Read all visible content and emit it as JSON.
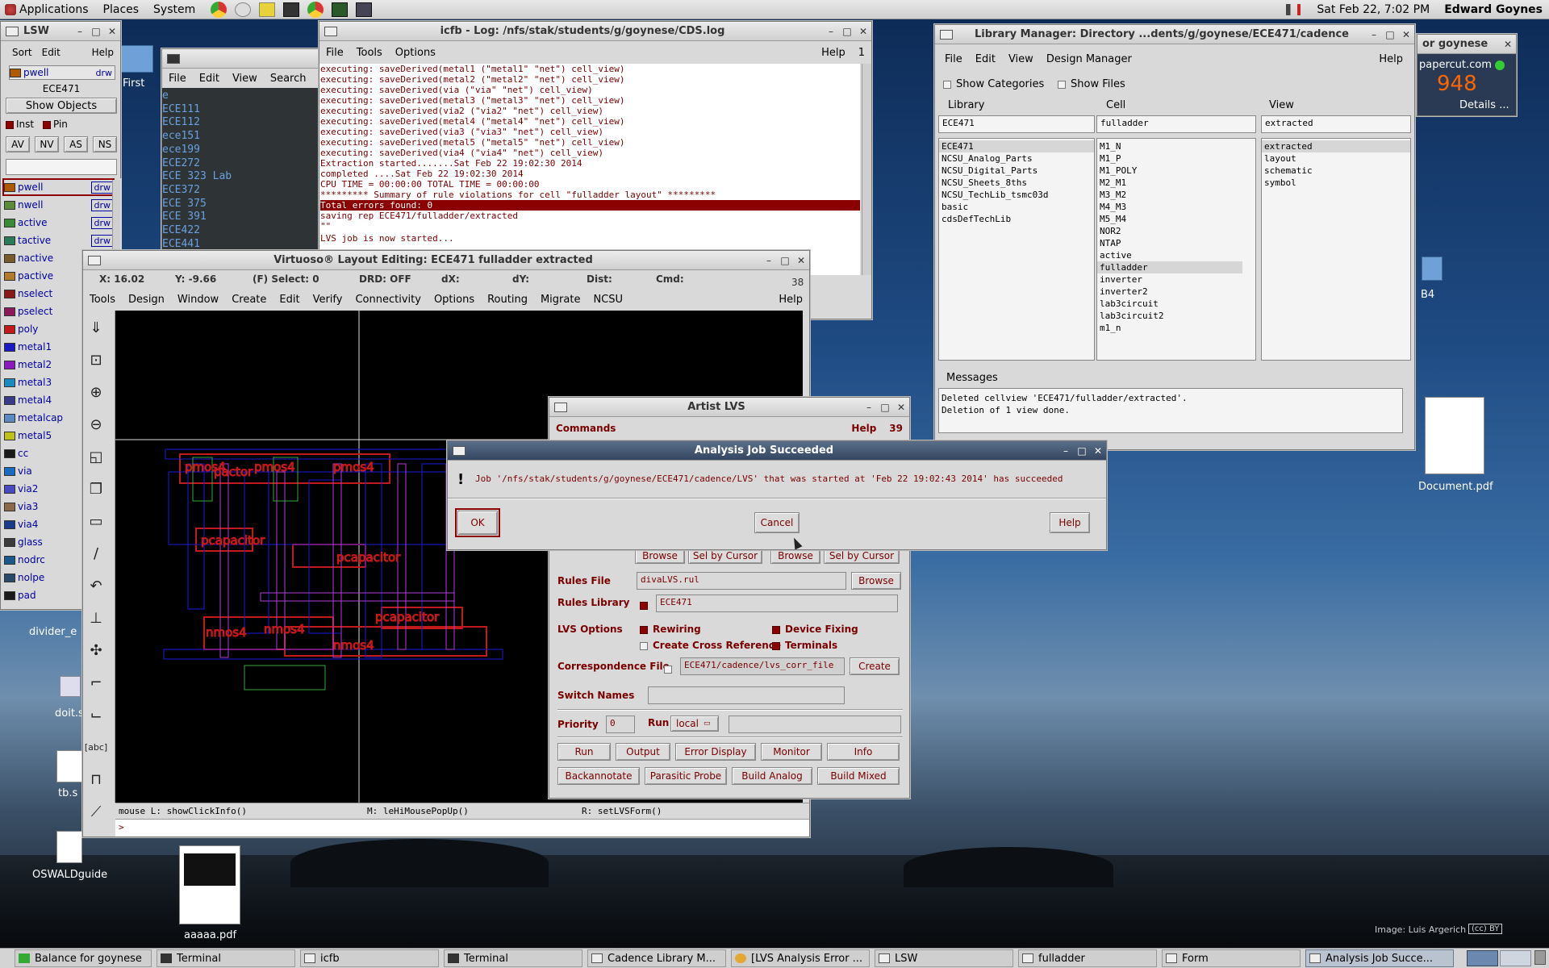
{
  "top_panel": {
    "applications": "Applications",
    "places": "Places",
    "system": "System",
    "clock": "Sat Feb 22,  7:02 PM",
    "user": "Edward Goynes"
  },
  "desktop": {
    "first_label": "First",
    "b4_label": "B4",
    "divider_label": "divider_e",
    "doit_label": "doit.s",
    "tb_label": "tb.s",
    "oswald_label": "OSWALDguide",
    "document_label": "Document.pdf",
    "aaaaa_label": "aaaaa.pdf",
    "credit": "Image: Luis Argerich",
    "cc": "(cc) BY"
  },
  "papercut": {
    "title": "or goynese",
    "site": "papercut.com",
    "count": "948",
    "details": "Details ..."
  },
  "lsw": {
    "title": "LSW",
    "menu": [
      "Sort",
      "Edit",
      "Help"
    ],
    "current_layer": "pwell",
    "current_purpose": "drw",
    "lib": "ECE471",
    "show_objects": "Show Objects",
    "inst": "Inst",
    "pin": "Pin",
    "buttons": [
      "AV",
      "NV",
      "AS",
      "NS"
    ],
    "layers": [
      {
        "name": "pwell",
        "purpose": "drw",
        "color": "#b05a00"
      },
      {
        "name": "nwell",
        "purpose": "drw",
        "color": "#5a8a3a"
      },
      {
        "name": "active",
        "purpose": "drw",
        "color": "#3a8a3a"
      },
      {
        "name": "tactive",
        "purpose": "drw",
        "color": "#2a7a5a"
      },
      {
        "name": "nactive",
        "purpose": "",
        "color": "#7a5a2a"
      },
      {
        "name": "pactive",
        "purpose": "",
        "color": "#b07a2a"
      },
      {
        "name": "nselect",
        "purpose": "",
        "color": "#8a1a1a"
      },
      {
        "name": "pselect",
        "purpose": "",
        "color": "#8a1a5a"
      },
      {
        "name": "poly",
        "purpose": "",
        "color": "#c01a1a"
      },
      {
        "name": "metal1",
        "purpose": "",
        "color": "#1a1ac0"
      },
      {
        "name": "metal2",
        "purpose": "",
        "color": "#8a1ac0"
      },
      {
        "name": "metal3",
        "purpose": "",
        "color": "#1a8ac0"
      },
      {
        "name": "metal4",
        "purpose": "",
        "color": "#3a3a8a"
      },
      {
        "name": "metalcap",
        "purpose": "",
        "color": "#5a8ac0"
      },
      {
        "name": "metal5",
        "purpose": "",
        "color": "#c0c01a"
      },
      {
        "name": "cc",
        "purpose": "",
        "color": "#1a1a1a"
      },
      {
        "name": "via",
        "purpose": "",
        "color": "#1a6ac0"
      },
      {
        "name": "via2",
        "purpose": "",
        "color": "#4a4ac0"
      },
      {
        "name": "via3",
        "purpose": "",
        "color": "#8a6a4a"
      },
      {
        "name": "via4",
        "purpose": "",
        "color": "#1a3a8a"
      },
      {
        "name": "glass",
        "purpose": "",
        "color": "#3a3a3a"
      },
      {
        "name": "nodrc",
        "purpose": "",
        "color": "#1a5a8a"
      },
      {
        "name": "nolpe",
        "purpose": "",
        "color": "#2a4a6a"
      },
      {
        "name": "pad",
        "purpose": "",
        "color": "#1a1a1a"
      }
    ]
  },
  "terminal": {
    "menu": [
      "File",
      "Edit",
      "View",
      "Search",
      "Te"
    ],
    "lines": [
      "e",
      "ECE111",
      "ECE112",
      "ece151",
      "ece199",
      "ECE272",
      "ECE 323 Lab",
      "ECE372",
      "ECE 375",
      "ECE 391",
      "ECE422",
      "ECE441"
    ]
  },
  "icfb": {
    "title": "icfb - Log: /nfs/stak/students/g/goynese/CDS.log",
    "menu": [
      "File",
      "Tools",
      "Options"
    ],
    "help": "Help",
    "num": "1",
    "lines": [
      "executing: saveDerived(metal1 (\"metal1\" \"net\") cell_view)",
      "executing: saveDerived(metal2 (\"metal2\" \"net\") cell_view)",
      "executing: saveDerived(via (\"via\" \"net\") cell_view)",
      "executing: saveDerived(metal3 (\"metal3\" \"net\") cell_view)",
      "executing: saveDerived(via2 (\"via2\" \"net\") cell_view)",
      "executing: saveDerived(metal4 (\"metal4\" \"net\") cell_view)",
      "executing: saveDerived(via3 (\"via3\" \"net\") cell_view)",
      "executing: saveDerived(metal5 (\"metal5\" \"net\") cell_view)",
      "executing: saveDerived(via4 (\"via4\" \"net\") cell_view)",
      "Extraction started.......Sat Feb 22 19:02:30 2014",
      "           completed ....Sat Feb 22 19:02:30 2014",
      "    CPU TIME = 00:00:00  TOTAL TIME = 00:00:00",
      "*********   Summary of rule violations for cell \"fulladder layout\"   *********",
      "    Total errors found: 0",
      "saving rep ECE471/fulladder/extracted",
      "\"\"",
      "LVS job is now started..."
    ]
  },
  "library_manager": {
    "title": "Library Manager: Directory ...dents/g/goynese/ECE471/cadence",
    "menu": [
      "File",
      "Edit",
      "View",
      "Design Manager"
    ],
    "help": "Help",
    "show_categories": "Show Categories",
    "show_files": "Show Files",
    "lib_header": "Library",
    "cell_header": "Cell",
    "view_header": "View",
    "lib_value": "ECE471",
    "cell_value": "fulladder",
    "view_value": "extracted",
    "libraries": [
      "ECE471",
      "NCSU_Analog_Parts",
      "NCSU_Digital_Parts",
      "NCSU_Sheets_8ths",
      "NCSU_TechLib_tsmc03d",
      "basic",
      "cdsDefTechLib"
    ],
    "cells": [
      "M1_N",
      "M1_P",
      "M1_POLY",
      "M2_M1",
      "M3_M2",
      "M4_M3",
      "M5_M4",
      "NOR2",
      "NTAP",
      "active",
      "fulladder",
      "inverter",
      "inverter2",
      "lab3circuit",
      "lab3circuit2",
      "m1_n"
    ],
    "views": [
      "extracted",
      "layout",
      "schematic",
      "symbol"
    ],
    "messages_label": "Messages",
    "messages": [
      "Deleted cellview 'ECE471/fulladder/extracted'.",
      "Deletion of 1 view done."
    ]
  },
  "virtuoso": {
    "title": "Virtuoso® Layout Editing: ECE471 fulladder extracted",
    "x": "X: 16.02",
    "y": "Y: -9.66",
    "select": "(F) Select: 0",
    "drd": "DRD: OFF",
    "dx": "dX:",
    "dy": "dY:",
    "dist": "Dist:",
    "cmd": "Cmd:",
    "num": "38",
    "menu": [
      "Tools",
      "Design",
      "Window",
      "Create",
      "Edit",
      "Verify",
      "Connectivity",
      "Options",
      "Routing",
      "Migrate",
      "NCSU"
    ],
    "help": "Help",
    "mouse_l": "mouse L: showClickInfo()",
    "mouse_m": "M: leHiMousePopUp()",
    "mouse_r": "R: setLVSForm()",
    "prompt": ">",
    "layout_labels": [
      "pmos4",
      "pmos4",
      "pmos4",
      "pactor",
      "pcapacitor",
      "pcapacitor",
      "pcapacitor",
      "nmos4",
      "nmos4",
      "nmos4"
    ]
  },
  "artist_lvs": {
    "title": "Artist LVS",
    "commands": "Commands",
    "help": "Help",
    "num": "39",
    "browse1": "Browse",
    "selcursor1": "Sel by Cursor",
    "browse2": "Browse",
    "selcursor2": "Sel by Cursor",
    "rules_file_label": "Rules File",
    "rules_file": "divaLVS.rul",
    "browse3": "Browse",
    "rules_lib_label": "Rules Library",
    "rules_lib": "ECE471",
    "lvs_options": "LVS Options",
    "rewiring": "Rewiring",
    "device_fixing": "Device Fixing",
    "create_xref": "Create Cross Reference",
    "terminals": "Terminals",
    "corr_label": "Correspondence File",
    "corr_file": "ECE471/cadence/lvs_corr_file",
    "create": "Create",
    "switch_label": "Switch Names",
    "priority_label": "Priority",
    "priority": "0",
    "run_label": "Run",
    "run_mode": "local",
    "buttons_row1": [
      "Run",
      "Output",
      "Error Display",
      "Monitor",
      "Info"
    ],
    "buttons_row2": [
      "Backannotate",
      "Parasitic Probe",
      "Build Analog",
      "Build Mixed"
    ]
  },
  "dialog": {
    "title": "Analysis Job Succeeded",
    "message": "Job '/nfs/stak/students/g/goynese/ECE471/cadence/LVS' that was started at 'Feb 22 19:02:43 2014' has succeeded",
    "ok": "OK",
    "cancel": "Cancel",
    "help": "Help"
  },
  "taskbar": [
    "Balance for goynese",
    "Terminal",
    "icfb",
    "Terminal",
    "Cadence Library M...",
    "[LVS Analysis Error ...",
    "LSW",
    "fulladder",
    "Form",
    "Analysis Job Succe..."
  ]
}
